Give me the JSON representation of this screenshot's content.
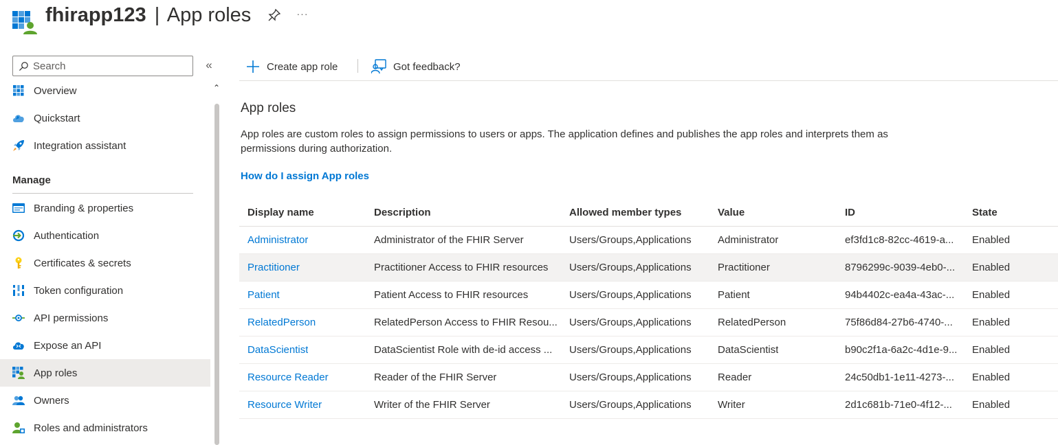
{
  "header": {
    "app_name": "fhirapp123",
    "separator": "|",
    "page_title": "App roles",
    "pin_icon": "pin-icon",
    "more_icon": "more-options-icon",
    "more_label": "···"
  },
  "sidebar": {
    "search_placeholder": "Search",
    "collapse_label": "«",
    "scroll_up_label": "⌃",
    "items": [
      {
        "label": "Overview",
        "icon": "overview-grid-icon"
      },
      {
        "label": "Quickstart",
        "icon": "quickstart-cloud-icon"
      },
      {
        "label": "Integration assistant",
        "icon": "rocket-icon"
      }
    ],
    "manage_section": "Manage",
    "manage_items": [
      {
        "label": "Branding & properties",
        "icon": "branding-icon"
      },
      {
        "label": "Authentication",
        "icon": "authentication-icon"
      },
      {
        "label": "Certificates & secrets",
        "icon": "key-icon"
      },
      {
        "label": "Token configuration",
        "icon": "token-bars-icon"
      },
      {
        "label": "API permissions",
        "icon": "api-permissions-icon"
      },
      {
        "label": "Expose an API",
        "icon": "expose-api-cloud-icon"
      },
      {
        "label": "App roles",
        "icon": "app-roles-icon",
        "active": true
      },
      {
        "label": "Owners",
        "icon": "owners-icon"
      },
      {
        "label": "Roles and administrators",
        "icon": "roles-admin-icon"
      }
    ]
  },
  "toolbar": {
    "create_label": "Create app role",
    "feedback_label": "Got feedback?"
  },
  "content": {
    "title": "App roles",
    "description": "App roles are custom roles to assign permissions to users or apps. The application defines and publishes the app roles and interprets them as permissions during authorization.",
    "help_link": "How do I assign App roles"
  },
  "table": {
    "headers": [
      "Display name",
      "Description",
      "Allowed member types",
      "Value",
      "ID",
      "State"
    ],
    "rows": [
      {
        "name": "Administrator",
        "description": "Administrator of the FHIR Server",
        "types": "Users/Groups,Applications",
        "value": "Administrator",
        "id": "ef3fd1c8-82cc-4619-a...",
        "state": "Enabled"
      },
      {
        "name": "Practitioner",
        "description": "Practitioner Access to FHIR resources",
        "types": "Users/Groups,Applications",
        "value": "Practitioner",
        "id": "8796299c-9039-4eb0-...",
        "state": "Enabled"
      },
      {
        "name": "Patient",
        "description": "Patient Access to FHIR resources",
        "types": "Users/Groups,Applications",
        "value": "Patient",
        "id": "94b4402c-ea4a-43ac-...",
        "state": "Enabled"
      },
      {
        "name": "RelatedPerson",
        "description": "RelatedPerson Access to FHIR Resou...",
        "types": "Users/Groups,Applications",
        "value": "RelatedPerson",
        "id": "75f86d84-27b6-4740-...",
        "state": "Enabled"
      },
      {
        "name": "DataScientist",
        "description": "DataScientist Role with de-id access ...",
        "types": "Users/Groups,Applications",
        "value": "DataScientist",
        "id": "b90c2f1a-6a2c-4d1e-9...",
        "state": "Enabled"
      },
      {
        "name": "Resource Reader",
        "description": "Reader of the FHIR Server",
        "types": "Users/Groups,Applications",
        "value": "Reader",
        "id": "24c50db1-1e11-4273-...",
        "state": "Enabled"
      },
      {
        "name": "Resource Writer",
        "description": "Writer of the FHIR Server",
        "types": "Users/Groups,Applications",
        "value": "Writer",
        "id": "2d1c681b-71e0-4f12-...",
        "state": "Enabled"
      }
    ]
  },
  "colors": {
    "accent": "#0078d4",
    "active_nav": "#edebe9",
    "hover_row": "#f3f2f1"
  }
}
